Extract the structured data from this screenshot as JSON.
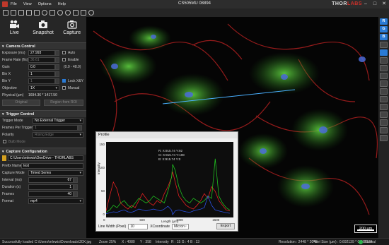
{
  "window": {
    "title": "CS505MU 08894"
  },
  "brand": {
    "prefix": "THOR",
    "accent": "LABS"
  },
  "menu": [
    "File",
    "View",
    "Options",
    "Help"
  ],
  "acquire": {
    "live": "Live",
    "snapshot": "Snapshot",
    "capture": "Capture"
  },
  "camera_control": {
    "heading": "Camera Control",
    "exposure": {
      "label": "Exposure (ms)",
      "value": "27.993",
      "check": "Auto"
    },
    "frame_rate": {
      "label": "Frame Rate (f/s)",
      "value": "36.61",
      "check": "Enable"
    },
    "gain": {
      "label": "Gain",
      "value": "0.0",
      "range": "(0.0 - 48.0)"
    },
    "bin_x": {
      "label": "Bin X",
      "value": "1"
    },
    "bin_y": {
      "label": "Bin Y",
      "value": "1",
      "check": "Lock X&Y"
    },
    "objective": {
      "label": "Objective",
      "value": "1X",
      "check": "Manual"
    },
    "physical": {
      "label": "Physical (µm)",
      "value": "1694.36 * 1417.50"
    },
    "original_btn": "Original",
    "roi_btn": "Region from ROI"
  },
  "trigger_control": {
    "heading": "Trigger Control",
    "mode": {
      "label": "Trigger Mode",
      "value": "No External Trigger"
    },
    "frames": {
      "label": "Frames Per Trigger",
      "value": "1"
    },
    "polarity": {
      "label": "Polarity",
      "value": "Rising Edge"
    },
    "bulb": "Bulb Mode"
  },
  "capture_config": {
    "heading": "Capture Configuration",
    "path": "C:\\Users\\mlewis\\OneDrive - THORLABS",
    "prefix": {
      "label": "Prefix Name",
      "value": "test"
    },
    "mode": {
      "label": "Capture Mode",
      "value": "Timed Series"
    },
    "interval": {
      "label": "Interval (ms)",
      "value": "67"
    },
    "duration": {
      "label": "Duration (s)",
      "value": "1"
    },
    "frames": {
      "label": "Frames",
      "value": "40"
    },
    "format": {
      "label": "Format",
      "value": "mp4"
    }
  },
  "right_tools": [
    "R",
    "G",
    "B"
  ],
  "profile": {
    "title": "Profile",
    "ylabel": "Intensity",
    "xlabel": "Length (µm)",
    "readout": [
      "R: X:915.74  Y:92",
      "G: X:915.74  Y:108",
      "B: X:915.74  Y:0"
    ],
    "line_width_label": "Line Width (Pixel)",
    "line_width": "10",
    "xcoord_label": "XCoordinate",
    "xcoord_unit": "Micron",
    "export": "Export"
  },
  "chart_data": {
    "type": "line",
    "xlabel": "Length (µm)",
    "ylabel": "Intensity",
    "xlim": [
      0,
      1750
    ],
    "ylim": [
      0,
      150
    ],
    "xticks": [
      0,
      500,
      1000,
      1500
    ],
    "yticks": [
      0,
      50,
      100,
      150
    ],
    "x": [
      0,
      50,
      100,
      150,
      200,
      250,
      300,
      350,
      400,
      450,
      500,
      550,
      600,
      650,
      700,
      750,
      800,
      850,
      900,
      915,
      950,
      1000,
      1050,
      1100,
      1150,
      1200,
      1250,
      1300,
      1350,
      1400,
      1450,
      1500,
      1550,
      1600,
      1650,
      1700
    ],
    "series": [
      {
        "color": "#e02020",
        "values": [
          8,
          40,
          70,
          55,
          25,
          18,
          12,
          20,
          15,
          30,
          45,
          35,
          25,
          20,
          30,
          25,
          45,
          60,
          80,
          92,
          70,
          40,
          30,
          20,
          15,
          12,
          20,
          30,
          45,
          35,
          60,
          50,
          30,
          20,
          10,
          8
        ]
      },
      {
        "color": "#20c020",
        "values": [
          5,
          10,
          20,
          15,
          25,
          30,
          20,
          15,
          25,
          35,
          30,
          25,
          30,
          40,
          35,
          30,
          25,
          50,
          80,
          108,
          95,
          60,
          40,
          30,
          25,
          35,
          30,
          25,
          30,
          40,
          35,
          120,
          40,
          25,
          15,
          10
        ]
      },
      {
        "color": "#2a50e0",
        "values": [
          2,
          4,
          6,
          5,
          8,
          10,
          6,
          5,
          8,
          12,
          10,
          8,
          10,
          12,
          10,
          8,
          12,
          18,
          10,
          0,
          8,
          10,
          8,
          6,
          5,
          8,
          10,
          12,
          15,
          40,
          20,
          10,
          8,
          6,
          4,
          3
        ]
      }
    ]
  },
  "scale_bar": "200 µm",
  "status": {
    "message": "Successfully loaded C:\\Users\\mlewis\\Downloads\\20X.jpg",
    "zoom": "Zoom 25%",
    "x": "X : 4080",
    "y": "Y : 358",
    "intensity": "Intensity",
    "rgb": "R : 15   G : 4   B : 13",
    "resolution": "Resolution : 2448 * 2048",
    "pixel": "Pixel Size (µm) : 0.692139 * 0.692139",
    "state": "Normal"
  }
}
